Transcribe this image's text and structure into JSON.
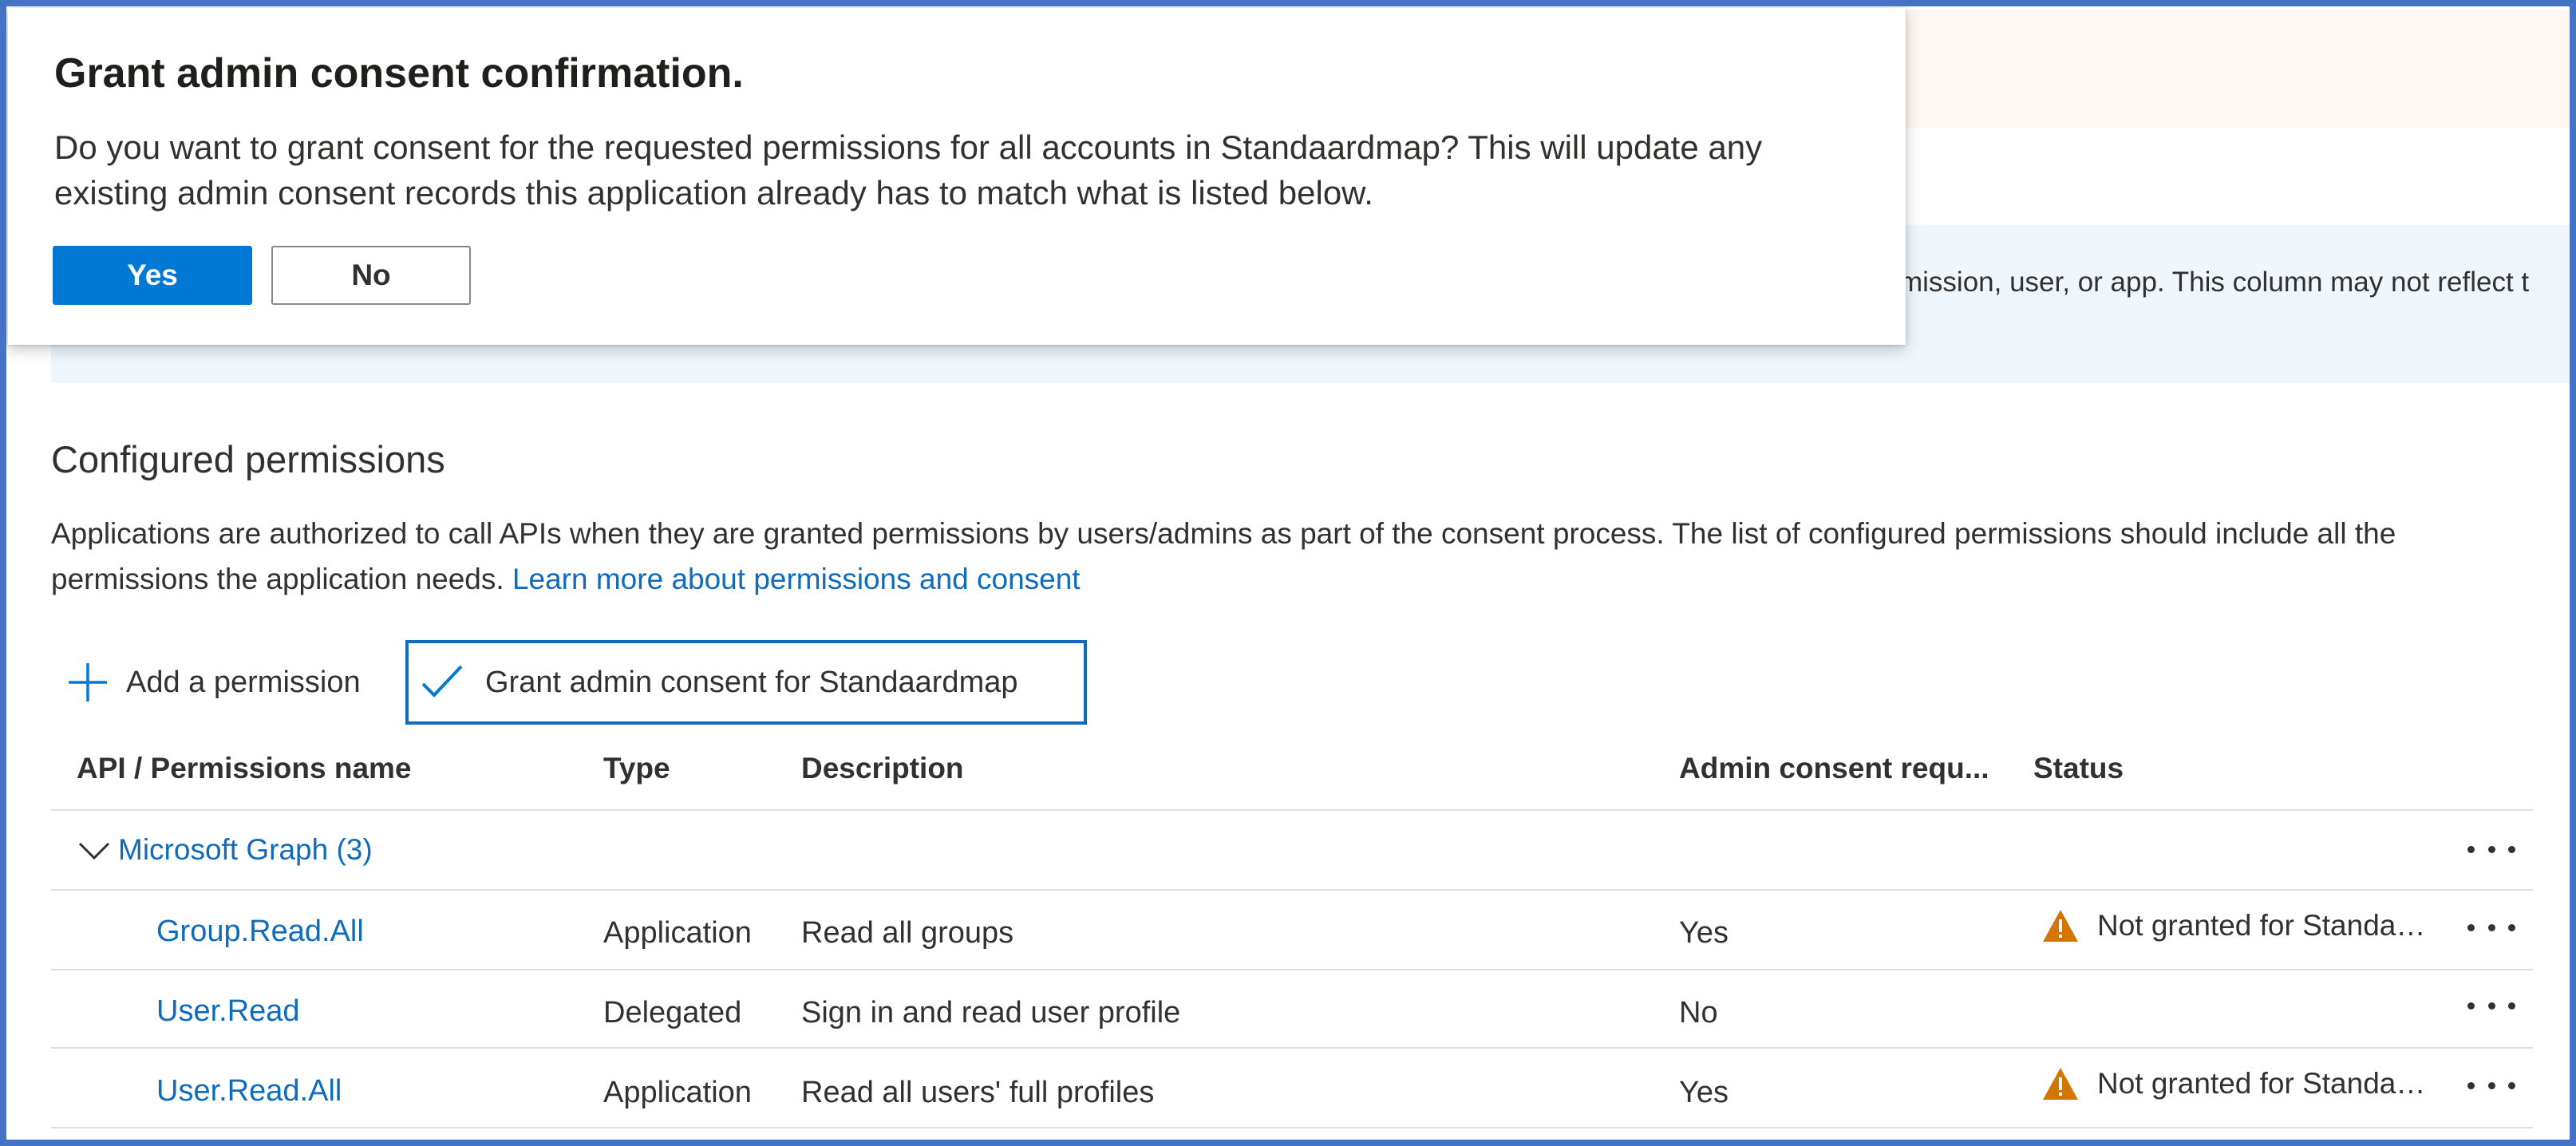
{
  "dialog": {
    "title": "Grant admin consent confirmation.",
    "message": "Do you want to grant consent for the requested permissions for all accounts in Standaardmap? This will update any existing admin consent records this application already has to match what is listed below.",
    "yes_label": "Yes",
    "no_label": "No"
  },
  "info_bar": {
    "text": "mission, user, or app. This column may not reflect t"
  },
  "section": {
    "title": "Configured permissions",
    "description": "Applications are authorized to call APIs when they are granted permissions by users/admins as part of the consent process. The list of configured permissions should include all the permissions the application needs. ",
    "link": "Learn more about permissions and consent"
  },
  "toolbar": {
    "add_label": "Add a permission",
    "grant_label": "Grant admin consent for Standaardmap"
  },
  "table": {
    "headers": [
      "API / Permissions name",
      "Type",
      "Description",
      "Admin consent requ...",
      "Status"
    ],
    "group": "Microsoft Graph (3)",
    "rows": [
      {
        "name": "Group.Read.All",
        "type": "Application",
        "description": "Read all groups",
        "admin": "Yes",
        "status": "Not granted for Standaardmap"
      },
      {
        "name": "User.Read",
        "type": "Delegated",
        "description": "Sign in and read user profile",
        "admin": "No",
        "status": ""
      },
      {
        "name": "User.Read.All",
        "type": "Application",
        "description": "Read all users' full profiles",
        "admin": "Yes",
        "status": "Not granted for Standaardmap"
      }
    ]
  },
  "colors": {
    "accent": "#0078d4",
    "link": "#0f6cbd",
    "warning": "#d47500",
    "frame": "#4472c4"
  },
  "icons": [
    "plus-icon",
    "check-icon",
    "chevron-down-icon",
    "warning-icon",
    "more-icon"
  ]
}
